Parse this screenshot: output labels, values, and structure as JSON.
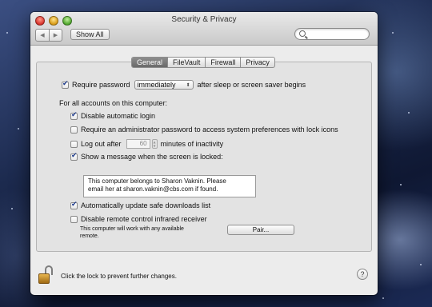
{
  "window": {
    "title": "Security & Privacy",
    "toolbar": {
      "back_icon": "chevron-left-icon",
      "forward_icon": "chevron-right-icon",
      "show_all_label": "Show All",
      "search_placeholder": ""
    }
  },
  "tabs": [
    {
      "label": "General",
      "active": true
    },
    {
      "label": "FileVault",
      "active": false
    },
    {
      "label": "Firewall",
      "active": false
    },
    {
      "label": "Privacy",
      "active": false
    }
  ],
  "general": {
    "require_password": {
      "checked": true,
      "label": "Require password",
      "select_value": "immediately",
      "suffix": "after sleep or screen saver begins"
    },
    "all_accounts_header": "For all accounts on this computer:",
    "disable_auto_login": {
      "checked": true,
      "label": "Disable automatic login"
    },
    "require_admin_password": {
      "checked": false,
      "label": "Require an administrator password to access system preferences with lock icons"
    },
    "log_out_after": {
      "checked": false,
      "label": "Log out after",
      "minutes_value": "60",
      "suffix": "minutes of inactivity"
    },
    "show_message": {
      "checked": true,
      "label": "Show a message when the screen is locked:"
    },
    "lock_message": "This computer belongs to Sharon Vaknin. Please\nemail her at sharon.vaknin@cbs.com if found.",
    "auto_update_downloads": {
      "checked": true,
      "label": "Automatically update safe downloads list"
    },
    "disable_ir_receiver": {
      "checked": false,
      "label": "Disable remote control infrared receiver"
    },
    "ir_note": "This computer will work with any available\nremote.",
    "pair_label": "Pair..."
  },
  "footer": {
    "lock_icon": "lock-open-icon",
    "lock_text": "Click the lock to prevent further changes.",
    "help_label": "?"
  },
  "colors": {
    "checkmark": "#1f3c8c",
    "lock_body": "#e8b650",
    "active_tab": "#7a7a7a"
  }
}
